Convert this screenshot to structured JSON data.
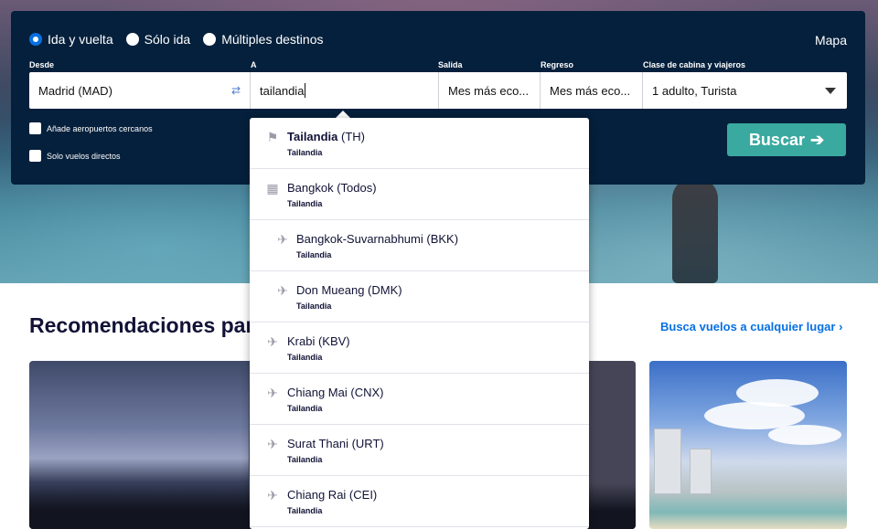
{
  "trip_type": {
    "options": [
      {
        "label": "Ida y vuelta",
        "selected": true
      },
      {
        "label": "Sólo ida",
        "selected": false
      },
      {
        "label": "Múltiples destinos",
        "selected": false
      }
    ]
  },
  "header": {
    "map_link": "Mapa"
  },
  "fields": {
    "from_label": "Desde",
    "from_value": "Madrid (MAD)",
    "to_label": "A",
    "to_value": "tailandia",
    "depart_label": "Salida",
    "depart_value": "Mes más eco...",
    "return_label": "Regreso",
    "return_value": "Mes más eco...",
    "cabin_label": "Clase de cabina y viajeros",
    "cabin_value": "1 adulto, Turista"
  },
  "options": {
    "nearby_airports": "Añade aeropuertos cercanos",
    "direct_only": "Solo vuelos directos"
  },
  "search_button": {
    "label": "Buscar",
    "arrow": "➔"
  },
  "recommendations": {
    "title": "Recomendaciones par",
    "any_place_link": "Busca vuelos a cualquier lugar ›"
  },
  "dropdown": {
    "items": [
      {
        "icon": "flag-icon",
        "name_bold": "Tailandia",
        "name_rest": " (TH)",
        "sub": "Tailandia",
        "indent": false
      },
      {
        "icon": "city-icon",
        "name_bold": "",
        "name_rest": "Bangkok (Todos)",
        "sub": "Tailandia",
        "indent": false
      },
      {
        "icon": "plane-icon",
        "name_bold": "",
        "name_rest": "Bangkok-Suvarnabhumi (BKK)",
        "sub": "Tailandia",
        "indent": true
      },
      {
        "icon": "plane-icon",
        "name_bold": "",
        "name_rest": "Don Mueang (DMK)",
        "sub": "Tailandia",
        "indent": true
      },
      {
        "icon": "plane-icon",
        "name_bold": "",
        "name_rest": "Krabi (KBV)",
        "sub": "Tailandia",
        "indent": false
      },
      {
        "icon": "plane-icon",
        "name_bold": "",
        "name_rest": "Chiang Mai (CNX)",
        "sub": "Tailandia",
        "indent": false
      },
      {
        "icon": "plane-icon",
        "name_bold": "",
        "name_rest": "Surat Thani (URT)",
        "sub": "Tailandia",
        "indent": false
      },
      {
        "icon": "plane-icon",
        "name_bold": "",
        "name_rest": "Chiang Rai (CEI)",
        "sub": "Tailandia",
        "indent": false
      }
    ]
  },
  "colors": {
    "panel_bg": "#05203c",
    "accent_blue": "#0770e3",
    "search_green": "#3aa99f"
  }
}
